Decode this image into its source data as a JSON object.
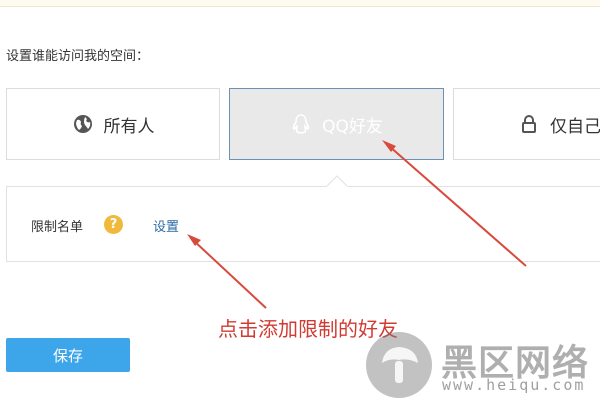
{
  "prompt": "设置谁能访问我的空间：",
  "access_options": [
    {
      "label": "所有人",
      "icon": "globe-icon"
    },
    {
      "label": "QQ好友",
      "icon": "qq-penguin-icon",
      "selected": true
    },
    {
      "label": "仅自己",
      "icon": "lock-icon"
    }
  ],
  "restriction": {
    "label": "限制名单",
    "help_icon": "help-icon",
    "help_text": "?",
    "settings_link": "设置"
  },
  "annotation": "点击添加限制的好友",
  "save_button": "保存",
  "watermark": {
    "text": "黑区网络",
    "url": "www.heiqu.com"
  },
  "colors": {
    "accent": "#3da6ea",
    "link": "#2a6aa6",
    "annotation": "#d13b33",
    "help_badge": "#f1b93c",
    "selected_border": "#6b93b7",
    "selected_bg": "#e9e9e9"
  }
}
